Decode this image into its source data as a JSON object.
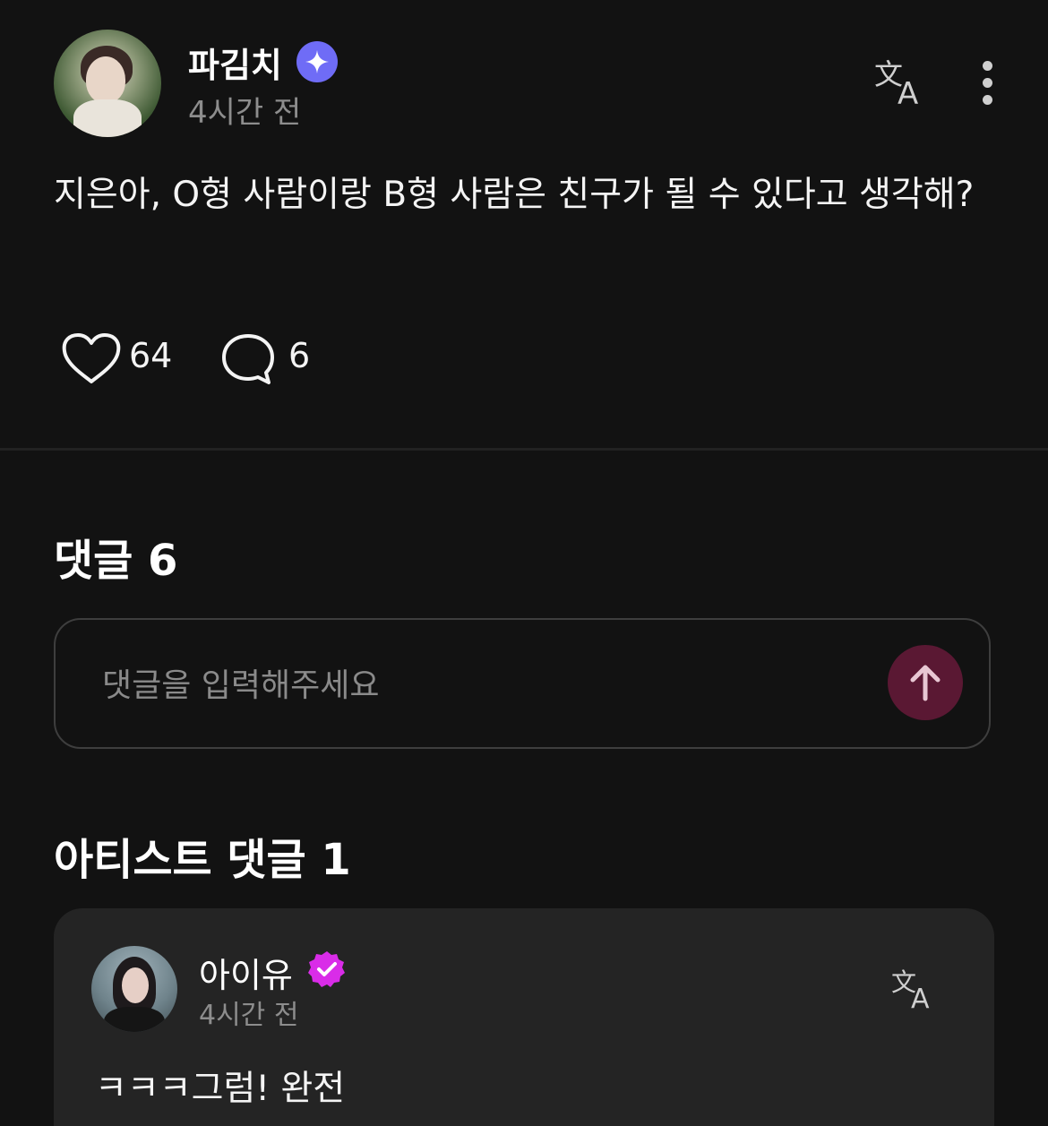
{
  "post": {
    "author_name": "파김치",
    "timestamp": "4시간 전",
    "body": "지은아, O형 사람이랑 B형 사람은 친구가 될 수 있다고 생각해?",
    "like_count": "64",
    "comment_count": "6",
    "icons": {
      "avatar": "user-avatar",
      "badge": "sparkle-badge-icon",
      "translate": "translate-icon",
      "more": "more-vertical-icon",
      "like": "heart-icon",
      "comment": "comment-bubble-icon"
    }
  },
  "comments_section": {
    "heading": "댓글 6",
    "input_placeholder": "댓글을 입력해주세요",
    "send_icon": "arrow-up-icon"
  },
  "artist_comments": {
    "heading": "아티스트 댓글 1",
    "items": [
      {
        "name": "아이유",
        "timestamp": "4시간 전",
        "text": "ㅋㅋㅋ그럼! 완전",
        "badge_icon": "verified-badge-icon"
      }
    ]
  },
  "colors": {
    "background": "#121212",
    "card_background": "#242424",
    "badge_blue": "#6f6cf6",
    "badge_pink": "#d92ce8",
    "send_button": "#5a1833",
    "secondary_text": "#8d8d8d"
  }
}
